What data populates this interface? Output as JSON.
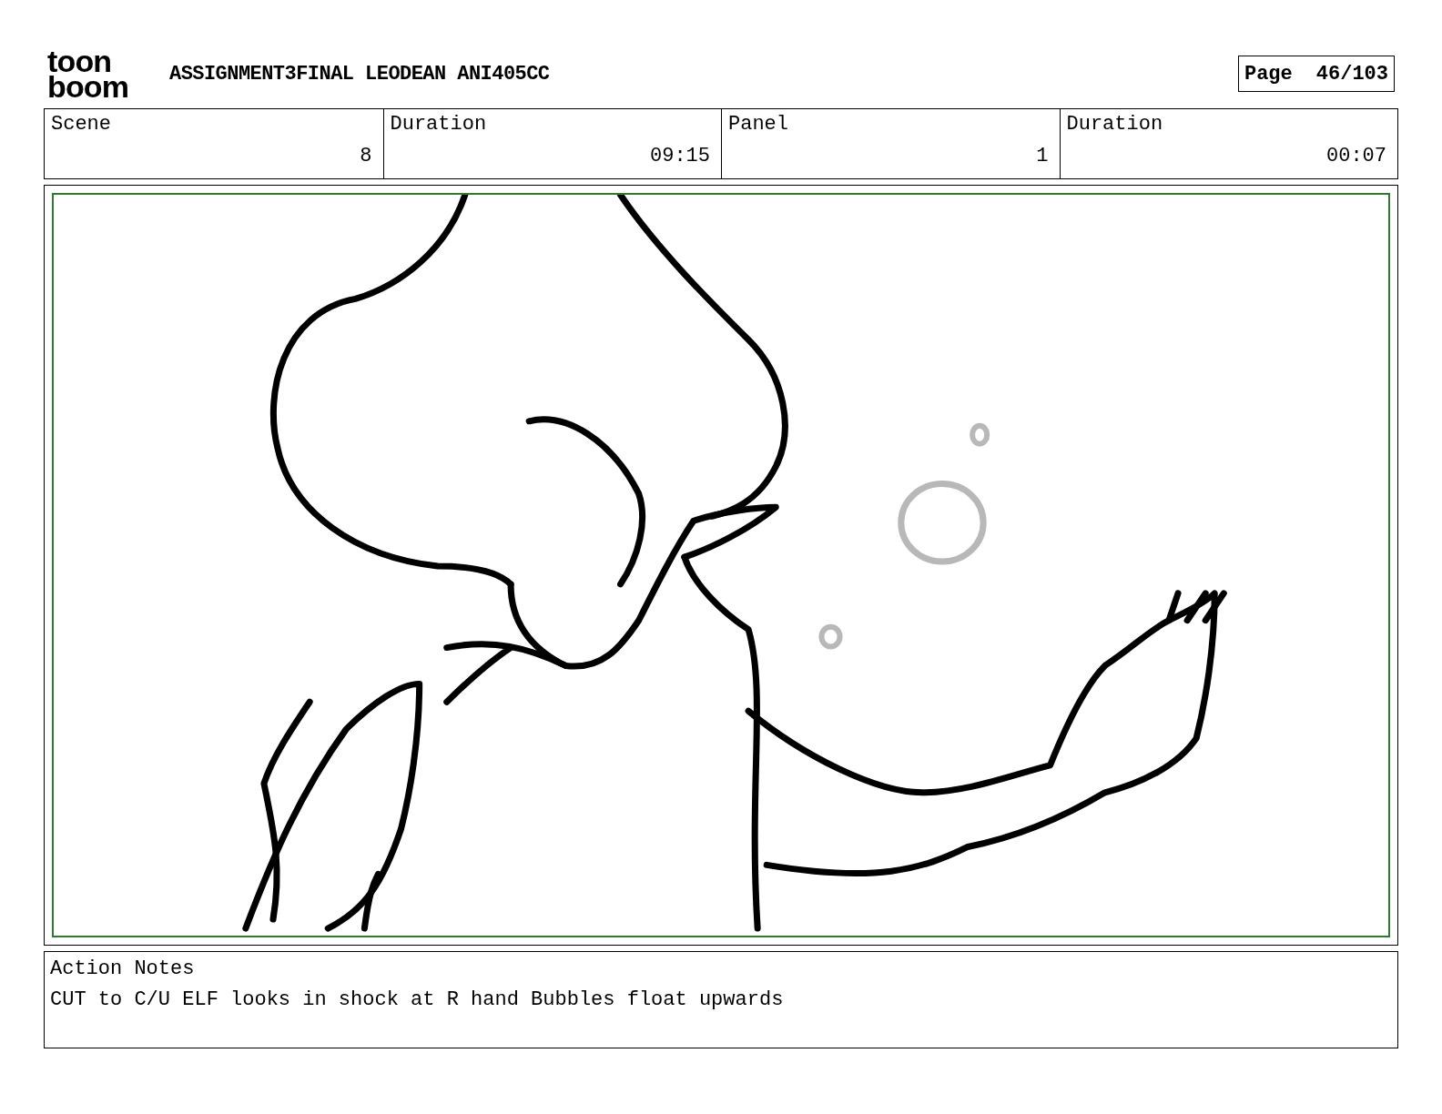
{
  "logo": {
    "lines": [
      "toon",
      "boom"
    ]
  },
  "title": "ASSIGNMENT3FINAL LEODEAN ANI405CC",
  "page": {
    "label": "Page",
    "value": "46/103"
  },
  "info": [
    {
      "label": "Scene",
      "value": "8"
    },
    {
      "label": "Duration",
      "value": "09:15"
    },
    {
      "label": "Panel",
      "value": "1"
    },
    {
      "label": "Duration",
      "value": "00:07"
    }
  ],
  "notes": {
    "label": "Action Notes",
    "text": "CUT to C/U ELF looks in shock at R hand Bubbles float upwards"
  }
}
